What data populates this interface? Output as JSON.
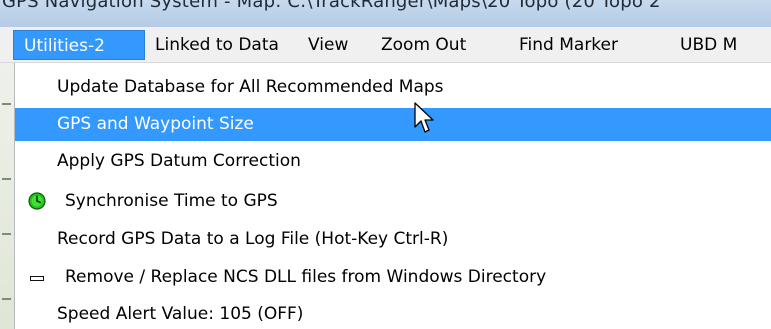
{
  "window": {
    "title": "GPS Navigation System - Map: C:\\TrackRanger\\Maps\\20 Topo (20 Topo 2"
  },
  "menubar": {
    "items": [
      {
        "label": "Utilities-2",
        "open": true
      },
      {
        "label": "Linked to Data"
      },
      {
        "label": "View"
      },
      {
        "label": "Zoom Out"
      },
      {
        "label": "Find Marker"
      },
      {
        "label": "UBD M"
      }
    ]
  },
  "dropdown": {
    "items": [
      {
        "label": "Update Database for All Recommended Maps",
        "icon": null,
        "highlighted": false
      },
      {
        "label": "GPS and Waypoint Size",
        "icon": null,
        "highlighted": true
      },
      {
        "label": "Apply GPS Datum Correction",
        "icon": null,
        "highlighted": false
      },
      {
        "label": "Synchronise Time to GPS",
        "icon": "green-clock-icon",
        "highlighted": false
      },
      {
        "label": "Record GPS Data to a Log File (Hot-Key Ctrl-R)",
        "icon": null,
        "highlighted": false
      },
      {
        "label": "Remove / Replace NCS DLL files from Windows Directory",
        "icon": "dash-icon",
        "highlighted": false
      },
      {
        "label": "Speed Alert Value: 105 (OFF)",
        "icon": null,
        "highlighted": false
      }
    ]
  },
  "colors": {
    "highlight": "#3399ff",
    "menubar_bg": "#f0f0f0",
    "titlebar_bg": "#c7daee",
    "clock_green": "#22c21a"
  },
  "cursor": {
    "icon": "arrow-cursor-icon"
  }
}
